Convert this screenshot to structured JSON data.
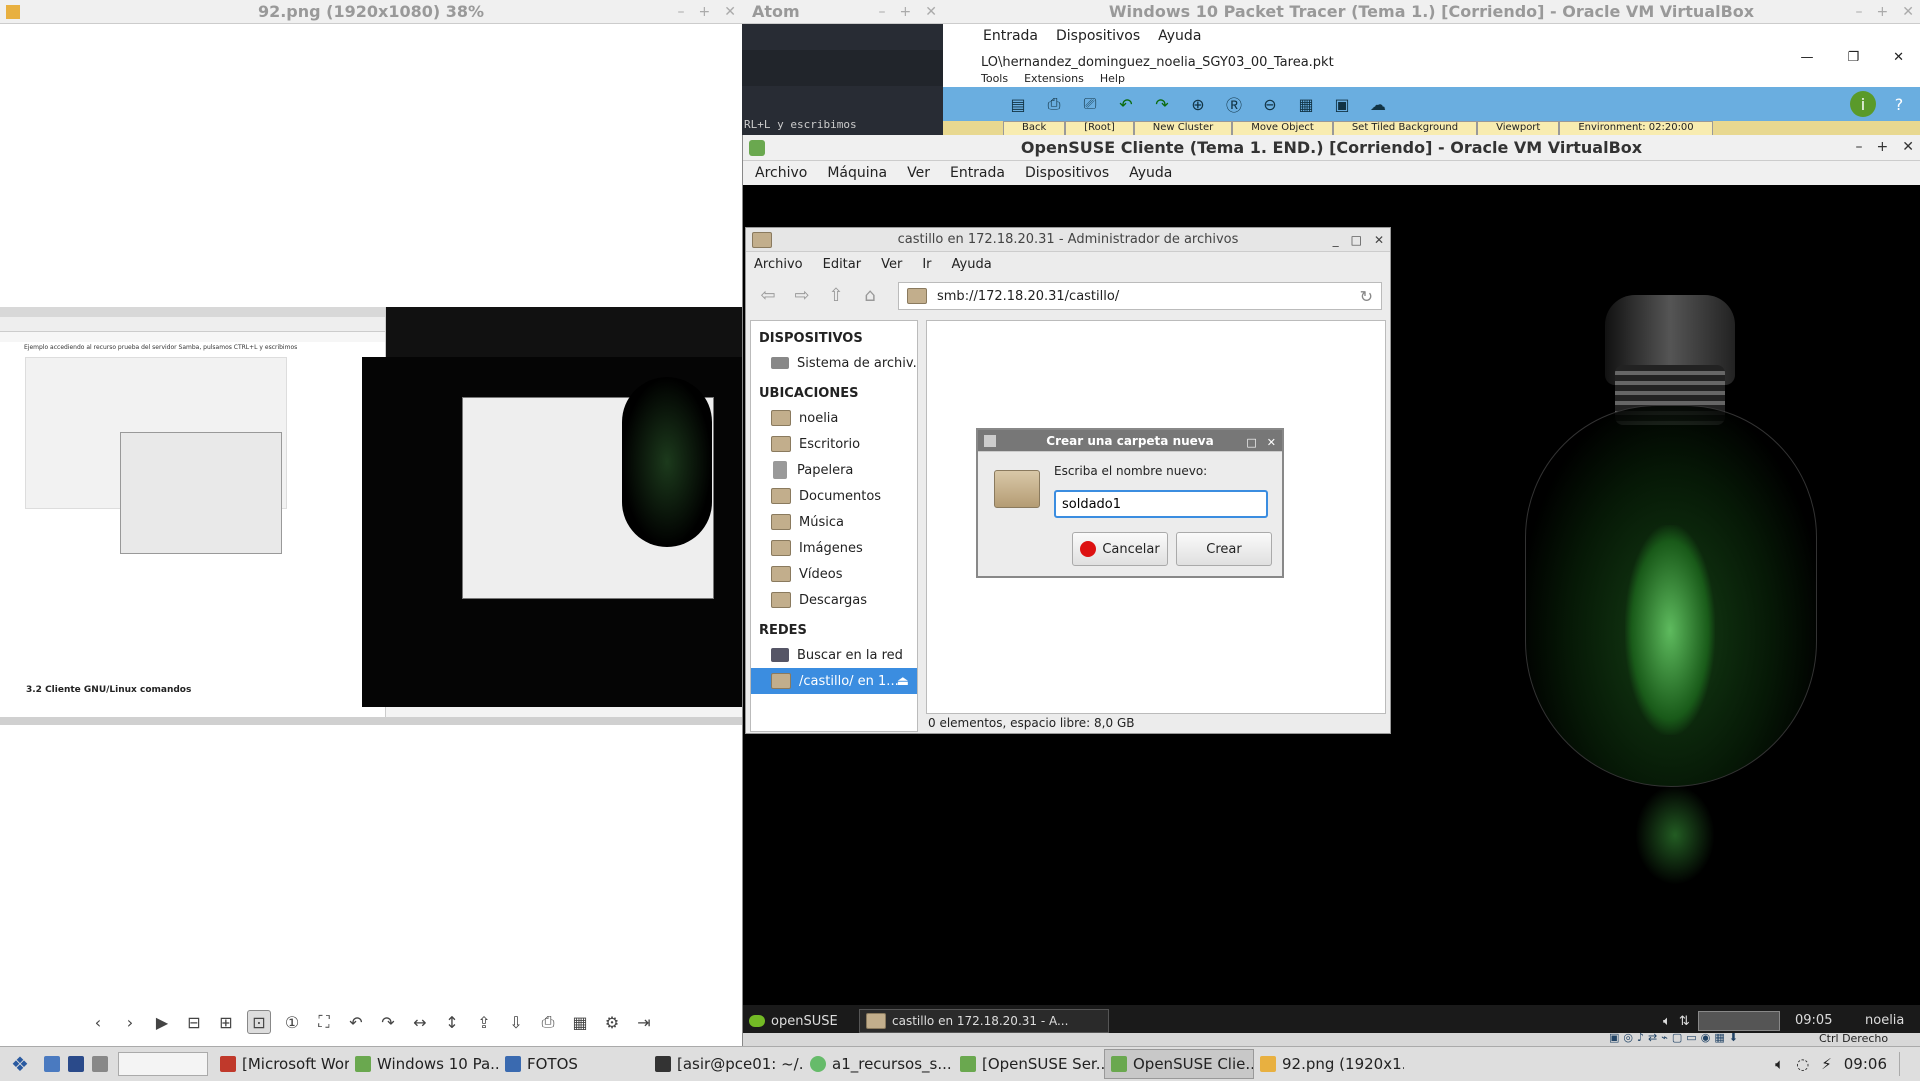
{
  "viewer": {
    "title": "92.png (1920x1080) 38%",
    "thumb_caption": "Ejemplo accediendo al recurso prueba del servidor Samba, pulsamos CTRL+L y escribimos",
    "thumb_section": "3.2 Cliente GNU/Linux comandos"
  },
  "atom": {
    "title": "Atom",
    "snippet": "RL+L y escribimos"
  },
  "pt": {
    "title": "Windows 10 Packet Tracer (Tema 1.) [Corriendo] - Oracle VM VirtualBox",
    "menu": [
      "Entrada",
      "Dispositivos",
      "Ayuda"
    ],
    "path": "LO\\hernandez_dominguez_noelia_SGY03_00_Tarea.pkt",
    "menu2": [
      "Tools",
      "Extensions",
      "Help"
    ],
    "strip": [
      "Back",
      "[Root]",
      "New Cluster",
      "Move Object",
      "Set Tiled Background",
      "Viewport",
      "Environment: 02:20:00"
    ]
  },
  "vbox": {
    "title": "OpenSUSE Cliente (Tema 1. END.) [Corriendo] - Oracle VM VirtualBox",
    "menu": [
      "Archivo",
      "Máquina",
      "Ver",
      "Entrada",
      "Dispositivos",
      "Ayuda"
    ]
  },
  "fm": {
    "title": "castillo en 172.18.20.31 - Administrador de archivos",
    "menu": [
      "Archivo",
      "Editar",
      "Ver",
      "Ir",
      "Ayuda"
    ],
    "path": "smb://172.18.20.31/castillo/",
    "sections": {
      "devices": "DISPOSITIVOS",
      "places": "UBICACIONES",
      "network": "REDES"
    },
    "devices": [
      "Sistema de archiv..."
    ],
    "places": [
      "noelia",
      "Escritorio",
      "Papelera",
      "Documentos",
      "Música",
      "Imágenes",
      "Vídeos",
      "Descargas"
    ],
    "network": [
      "Buscar en la red",
      "/castillo/ en 1..."
    ],
    "status": "0 elementos, espacio libre: 8,0 GB"
  },
  "dialog": {
    "title": "Crear una carpeta nueva",
    "prompt": "Escriba el nombre nuevo:",
    "value": "soldado1",
    "cancel": "Cancelar",
    "create": "Crear"
  },
  "guest_panel": {
    "start": "openSUSE",
    "task": "castillo en 172.18.20.31 - A...",
    "time": "09:05",
    "user": "noelia"
  },
  "host_status": {
    "host_key": "Ctrl Derecho"
  },
  "taskbar": {
    "items": [
      "[Microsoft Wor...",
      "Windows 10 Pa...",
      "FOTOS",
      "[asir@pce01: ~/...",
      "a1_recursos_s...",
      "[OpenSUSE Ser...",
      "OpenSUSE Clie...",
      "92.png (1920x1..."
    ],
    "time": "09:06"
  }
}
